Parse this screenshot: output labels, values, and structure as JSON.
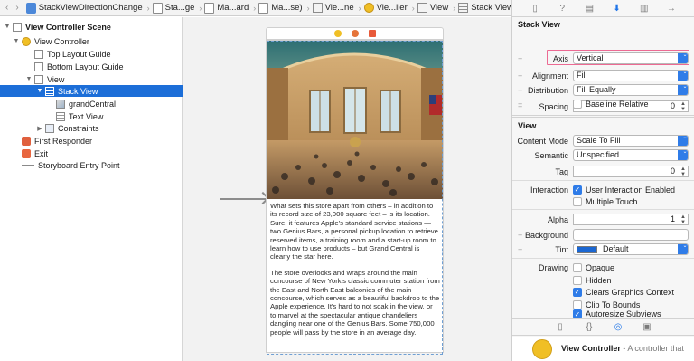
{
  "jumpbar": {
    "nav_back": "‹",
    "nav_forward": "›",
    "segments": [
      {
        "icon": "project-file-icon",
        "label": "StackViewDirectionChange"
      },
      {
        "icon": "folder-icon",
        "label": "Sta...ge"
      },
      {
        "icon": "storyboard-icon",
        "label": "Ma...ard"
      },
      {
        "icon": "storyboard-icon",
        "label": "Ma...se)"
      },
      {
        "icon": "view-icon",
        "label": "Vie...ne"
      },
      {
        "icon": "view-controller-icon",
        "label": "Vie...ller"
      },
      {
        "icon": "view-icon",
        "label": "View"
      },
      {
        "icon": "stack-view-icon",
        "label": "Stack View"
      }
    ]
  },
  "outline": {
    "scene": "View Controller Scene",
    "view_controller": "View Controller",
    "top_layout_guide": "Top Layout Guide",
    "bottom_layout_guide": "Bottom Layout Guide",
    "view": "View",
    "stack_view": "Stack View",
    "image_view": "grandCentral",
    "text_view": "Text View",
    "constraints": "Constraints",
    "first_responder": "First Responder",
    "exit": "Exit",
    "entry_point": "Storyboard Entry Point"
  },
  "canvas": {
    "text_paragraph_1": "What sets this store apart from others – in addition to its record size of 23,000 square feet – is its location. Sure, it features Apple's standard service stations — two Genius Bars, a personal pickup location to retrieve reserved items, a training room and a start-up room to learn how to use products – but Grand Central is clearly the star here.",
    "text_paragraph_2": "The store overlooks and wraps around the main concourse of New York's classic commuter station from the East and North East balconies of the main concourse, which serves as a beautiful backdrop to the Apple experience. It's hard to not soak in the view, or to marvel at the spectacular antique chandeliers dangling near one of the Genius Bars. Some 750,000 people will pass by the store in an average day."
  },
  "inspector": {
    "stack_view_title": "Stack View",
    "axis_label": "Axis",
    "axis_value": "Vertical",
    "alignment_label": "Alignment",
    "alignment_value": "Fill",
    "distribution_label": "Distribution",
    "distribution_value": "Fill Equally",
    "spacing_label": "Spacing",
    "spacing_value": "0",
    "baseline_relative": "Baseline Relative",
    "view_title": "View",
    "content_mode_label": "Content Mode",
    "content_mode_value": "Scale To Fill",
    "semantic_label": "Semantic",
    "semantic_value": "Unspecified",
    "tag_label": "Tag",
    "tag_value": "0",
    "interaction_label": "Interaction",
    "user_interaction": "User Interaction Enabled",
    "multiple_touch": "Multiple Touch",
    "alpha_label": "Alpha",
    "alpha_value": "1",
    "background_label": "Background",
    "tint_label": "Tint",
    "tint_value": "Default",
    "drawing_label": "Drawing",
    "opaque": "Opaque",
    "hidden": "Hidden",
    "clears_graphics": "Clears Graphics Context",
    "clip_to_bounds": "Clip To Bounds",
    "autoresize": "Autoresize Subviews",
    "library_title": "View Controller",
    "library_desc": " - A controller that",
    "colors": {
      "accent": "#2f7ce8",
      "selection": "#1c6ed8",
      "highlight_border": "#ec6a93",
      "tint_swatch": "#1b67d2"
    }
  }
}
